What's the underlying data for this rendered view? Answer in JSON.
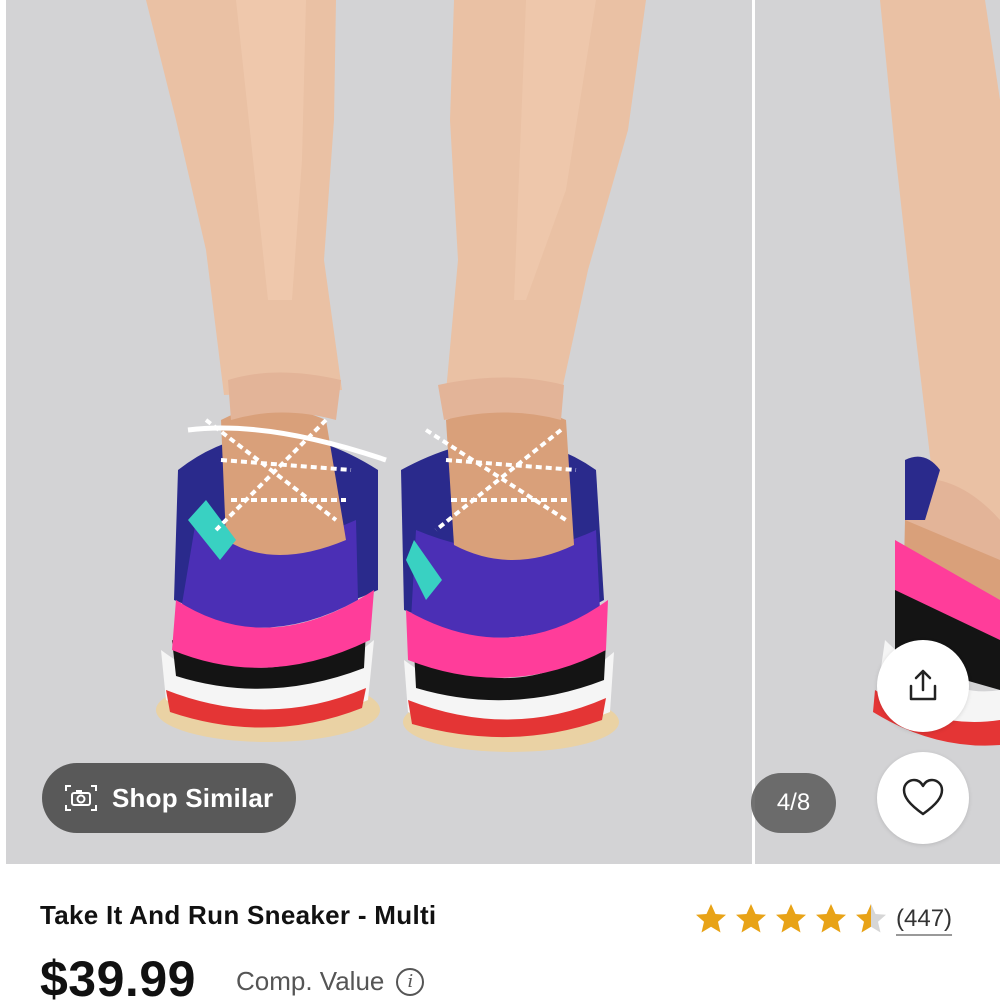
{
  "product": {
    "title": "Take It And Run Sneaker - Multi",
    "price": "$39.99",
    "comp_value_label": "Comp. Value",
    "rating": 4.5,
    "review_count": "(447)"
  },
  "gallery": {
    "shop_similar_label": "Shop Similar",
    "counter": "4/8",
    "image_subject": "multi-color sequin sneakers"
  },
  "icons": {
    "shop_similar": "camera-scan-icon",
    "share": "share-icon",
    "favorite": "heart-icon",
    "info": "info-icon",
    "star": "star-icon"
  },
  "colors": {
    "star": "#e8a317",
    "star_empty": "#d6d6d6",
    "pill_bg": "#484848",
    "image_bg": "#d3d3d5"
  }
}
